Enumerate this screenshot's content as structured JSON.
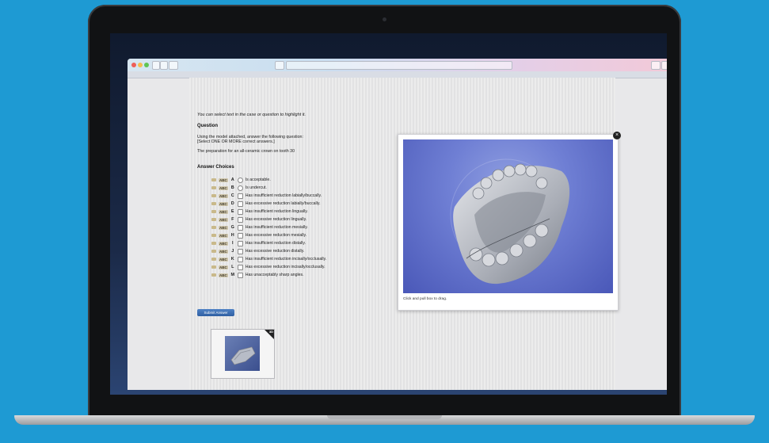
{
  "instructions": {
    "highlight_hint": "You can select text in the case or question to highlight it."
  },
  "question": {
    "heading": "Question",
    "prompt_line1": "Using the model attached, answer the following question:",
    "prompt_line2": "[Select ONE OR MORE correct answers.]",
    "stem": "The preparation for an all-ceramic crown on tooth 30"
  },
  "answers": {
    "heading": "Answer Choices",
    "abc_label": "ABC",
    "items": [
      {
        "letter": "A",
        "text": "Is acceptable."
      },
      {
        "letter": "B",
        "text": "Is undercut."
      },
      {
        "letter": "C",
        "text": "Has insufficient reduction labially/buccally."
      },
      {
        "letter": "D",
        "text": "Has excessive reduction labially/buccally."
      },
      {
        "letter": "E",
        "text": "Has insufficient reduction lingually."
      },
      {
        "letter": "F",
        "text": "Has excessive reduction lingually."
      },
      {
        "letter": "G",
        "text": "Has insufficient reduction mesially."
      },
      {
        "letter": "H",
        "text": "Has excessive reduction mesially."
      },
      {
        "letter": "I",
        "text": "Has insufficient reduction distally."
      },
      {
        "letter": "J",
        "text": "Has excessive reduction distally."
      },
      {
        "letter": "K",
        "text": "Has insufficient reduction incisally/occlusally."
      },
      {
        "letter": "L",
        "text": "Has excessive reduction incisally/occlusally."
      },
      {
        "letter": "M",
        "text": "Has unacceptably sharp angles."
      }
    ]
  },
  "submit_label": "Submit Answer",
  "thumbnail": {
    "badge": "3D"
  },
  "viewer": {
    "caption": "Click and pull box to drag.",
    "close_glyph": "×"
  },
  "colors": {
    "background": "#1e9ad3",
    "submit": "#3a6bb0",
    "viewport": "#6f7fd4"
  }
}
